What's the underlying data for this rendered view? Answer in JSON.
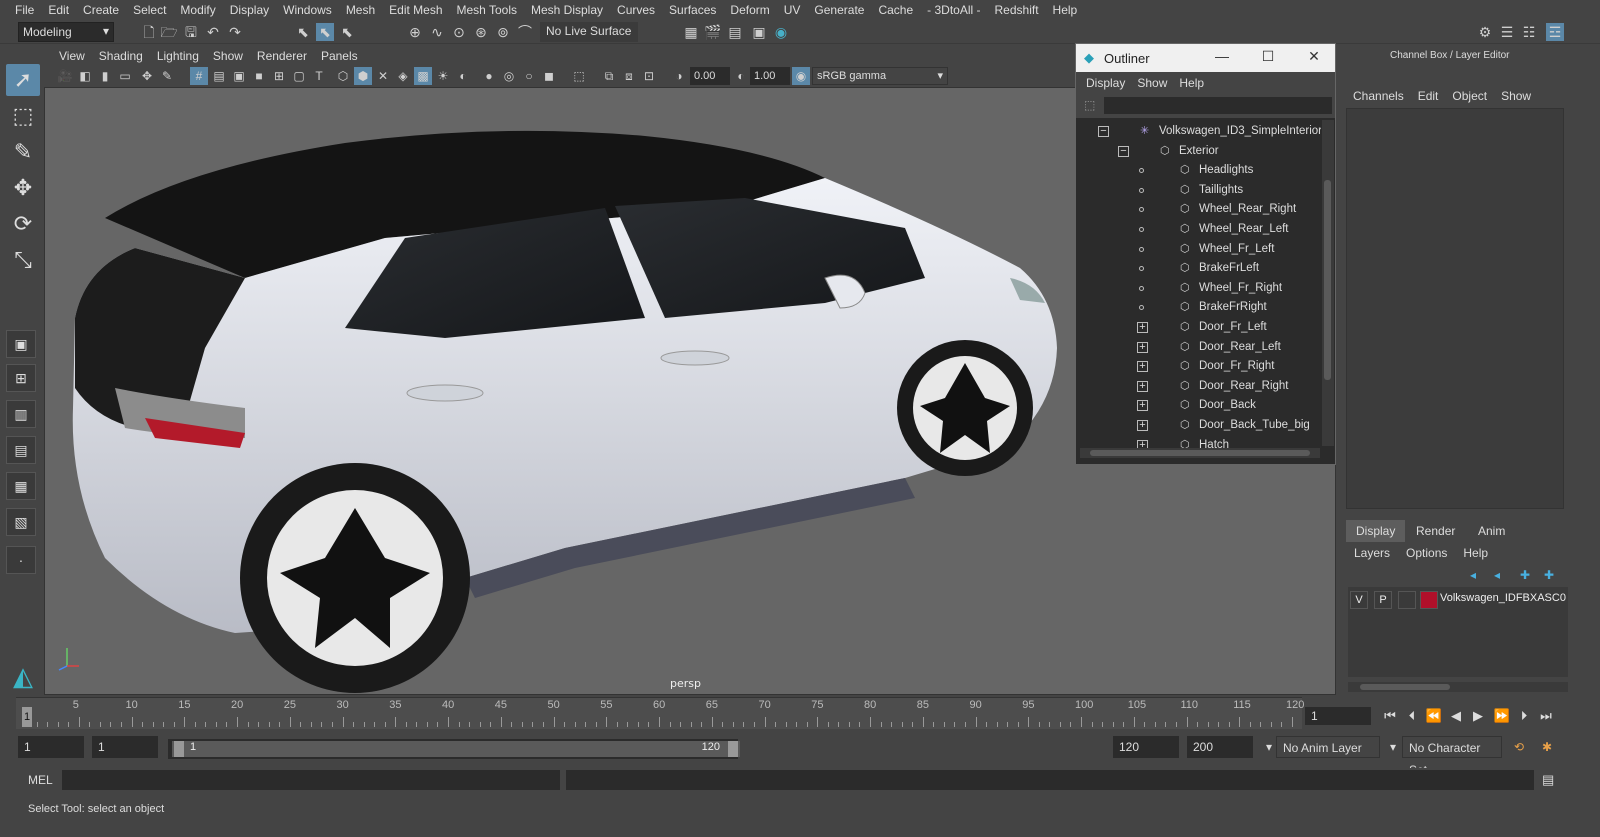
{
  "menubar": [
    "File",
    "Edit",
    "Create",
    "Select",
    "Modify",
    "Display",
    "Windows",
    "Mesh",
    "Edit Mesh",
    "Mesh Tools",
    "Mesh Display",
    "Curves",
    "Surfaces",
    "Deform",
    "UV",
    "Generate",
    "Cache",
    "- 3DtoAll -",
    "Redshift",
    "Help"
  ],
  "statusline": {
    "mode": "Modeling",
    "live_surface": "No Live Surface"
  },
  "viewport": {
    "menu": [
      "View",
      "Shading",
      "Lighting",
      "Show",
      "Renderer",
      "Panels"
    ],
    "exposure": "0.00",
    "gamma": "1.00",
    "color_space": "sRGB gamma",
    "camera_label": "persp"
  },
  "outliner": {
    "title": "Outliner",
    "menu": [
      "Display",
      "Show",
      "Help"
    ],
    "items": [
      {
        "label": "Volkswagen_ID3_SimpleInterior",
        "icon": "asterisk-group"
      },
      {
        "label": "Exterior"
      },
      {
        "label": "Headlights"
      },
      {
        "label": "Taillights"
      },
      {
        "label": "Wheel_Rear_Right"
      },
      {
        "label": "Wheel_Rear_Left"
      },
      {
        "label": "Wheel_Fr_Left"
      },
      {
        "label": "BrakeFrLeft"
      },
      {
        "label": "Wheel_Fr_Right"
      },
      {
        "label": "BrakeFrRight"
      },
      {
        "label": "Door_Fr_Left"
      },
      {
        "label": "Door_Rear_Left"
      },
      {
        "label": "Door_Fr_Right"
      },
      {
        "label": "Door_Rear_Right"
      },
      {
        "label": "Door_Back"
      },
      {
        "label": "Door_Back_Tube_big"
      },
      {
        "label": "Hatch"
      }
    ]
  },
  "channelbox": {
    "title": "Channel Box / Layer Editor",
    "menu": [
      "Channels",
      "Edit",
      "Object",
      "Show"
    ]
  },
  "layereditor": {
    "tabs": [
      "Display",
      "Render",
      "Anim"
    ],
    "menu": [
      "Layers",
      "Options",
      "Help"
    ],
    "layer": {
      "v": "V",
      "p": "P",
      "name": "Volkswagen_IDFBXASC0",
      "color": "#b0102a"
    }
  },
  "timeslider": {
    "ticks": [
      "5",
      "10",
      "15",
      "20",
      "25",
      "30",
      "35",
      "40",
      "45",
      "50",
      "55",
      "60",
      "65",
      "70",
      "75",
      "80",
      "85",
      "90",
      "95",
      "100",
      "105",
      "110",
      "115",
      "120"
    ],
    "current_marker": "1",
    "current_frame": "1"
  },
  "range": {
    "start": "1",
    "playback_start": "1",
    "range_inner_start": "1",
    "range_inner_end": "120",
    "playback_end": "120",
    "end": "200",
    "anim_layer": "No Anim Layer",
    "character_set": "No Character Set"
  },
  "cmdline": {
    "label": "MEL"
  },
  "helpline": {
    "text": "Select Tool: select an object"
  },
  "colors": {
    "viewport_bg": "#666666",
    "car_body": "#dfe3ea",
    "accent": "#5b88a8"
  }
}
